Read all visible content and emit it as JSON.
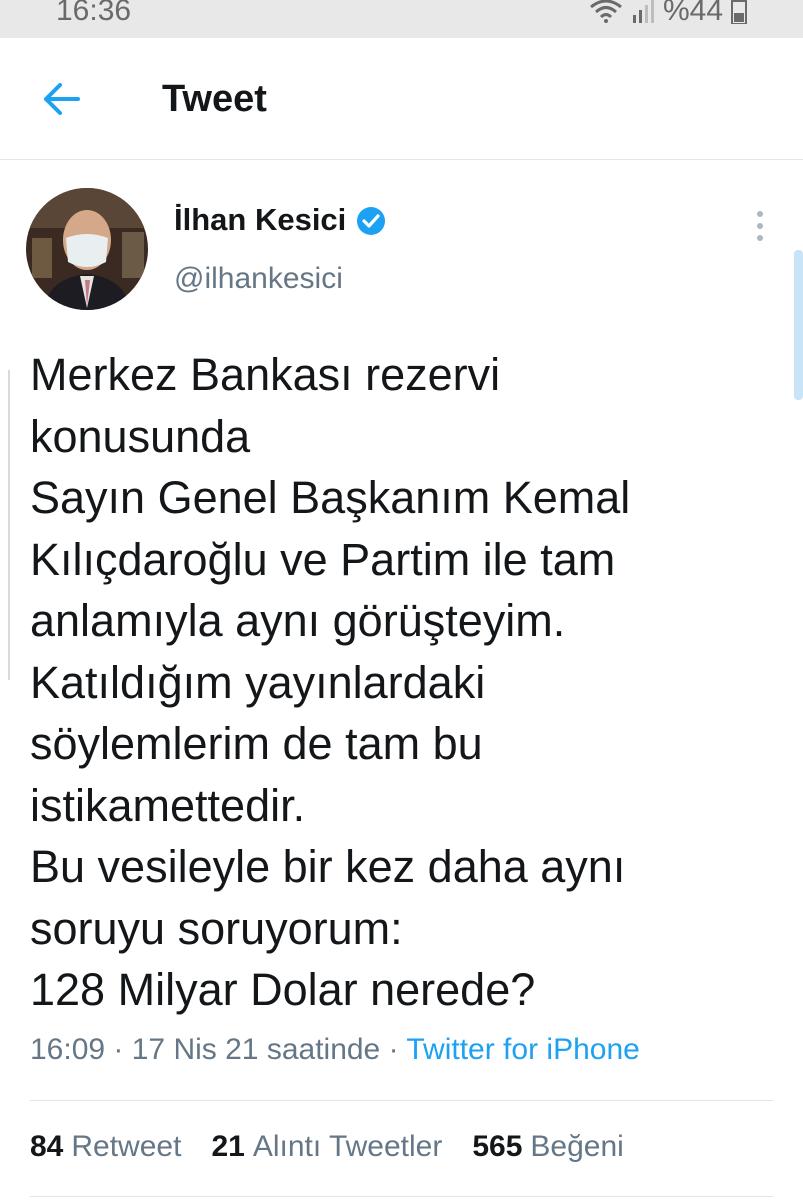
{
  "status_bar": {
    "time": "16:36",
    "battery_text": "%44",
    "icons": [
      "wifi-icon",
      "signal-icon",
      "battery-icon"
    ]
  },
  "header": {
    "title": "Tweet",
    "back_icon": "back-arrow-icon"
  },
  "author": {
    "name": "İlhan Kesici",
    "handle": "@ilhankesici",
    "verified": true,
    "avatar_icon": "avatar"
  },
  "tweet": {
    "text": "Merkez Bankası rezervi\nkonusunda\nSayın Genel Başkanım Kemal\nKılıçdaroğlu ve Partim ile tam\nanlamıyla aynı görüşteyim.\nKatıldığım yayınlardaki\nsöylemlerim de tam bu\nistikamettedir.\nBu vesileyle bir kez daha aynı\nsoruyu soruyorum:\n128 Milyar Dolar nerede?",
    "time": "16:09",
    "date": "17 Nis 21 saatinde",
    "source": "Twitter for iPhone",
    "separator": " · "
  },
  "stats": {
    "retweets_count": "84",
    "retweets_label": "Retweet",
    "quotes_count": "21",
    "quotes_label": "Alıntı Tweetler",
    "likes_count": "565",
    "likes_label": "Beğeni"
  },
  "colors": {
    "accent": "#1da1f2",
    "text_primary": "#14171a",
    "text_secondary": "#657786",
    "divider": "#e1e8ed"
  }
}
